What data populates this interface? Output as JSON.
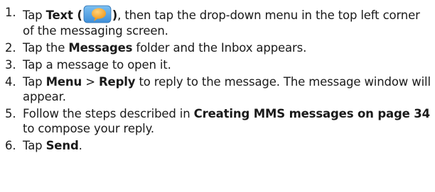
{
  "steps": [
    {
      "num": "1.",
      "parts": [
        {
          "t": "Tap ",
          "b": false
        },
        {
          "t": "Text (",
          "b": true
        },
        {
          "icon": "text-messaging-icon"
        },
        {
          "t": ")",
          "b": true
        },
        {
          "t": ", then tap the drop-down menu in the top left corner of the messaging screen.",
          "b": false
        }
      ]
    },
    {
      "num": "2.",
      "parts": [
        {
          "t": "Tap the ",
          "b": false
        },
        {
          "t": "Messages",
          "b": true
        },
        {
          "t": " folder and the Inbox appears.",
          "b": false
        }
      ]
    },
    {
      "num": "3.",
      "parts": [
        {
          "t": "Tap a message to open it.",
          "b": false
        }
      ]
    },
    {
      "num": "4.",
      "parts": [
        {
          "t": "Tap ",
          "b": false
        },
        {
          "t": "Menu",
          "b": true
        },
        {
          "t": " > ",
          "b": false
        },
        {
          "t": "Reply",
          "b": true
        },
        {
          "t": " to reply to the message. The message window will appear.",
          "b": false
        }
      ]
    },
    {
      "num": "5.",
      "parts": [
        {
          "t": "Follow the steps described in ",
          "b": false
        },
        {
          "t": "Creating MMS messages on page 34",
          "b": true
        },
        {
          "t": " to compose your reply.",
          "b": false
        }
      ]
    },
    {
      "num": "6.",
      "parts": [
        {
          "t": "Tap ",
          "b": false
        },
        {
          "t": "Send",
          "b": true
        },
        {
          "t": ".",
          "b": false
        }
      ]
    }
  ],
  "colors": {
    "icon_blue": "#3f8fd8",
    "icon_orange": "#f39b1e"
  }
}
